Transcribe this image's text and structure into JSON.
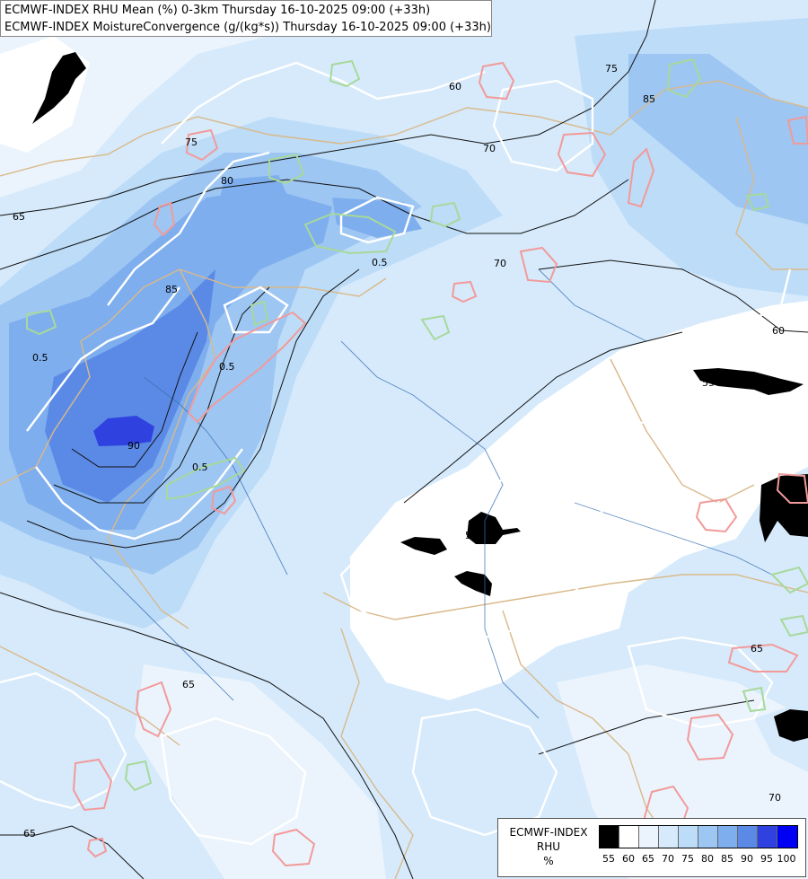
{
  "title": {
    "line1": "ECMWF-INDEX RHU Mean (%) 0-3km Thursday 16-10-2025 09:00 (+33h)",
    "line2": "ECMWF-INDEX MoistureConvergence (g/(kg*s)) Thursday 16-10-2025 09:00 (+33h)"
  },
  "legend": {
    "line1": "ECMWF-INDEX",
    "line2": "RHU",
    "unit": "%",
    "colors": [
      "#000000",
      "#ffffff",
      "#ebf4fd",
      "#d6eafb",
      "#bddcf8",
      "#9dc6f3",
      "#7eaeee",
      "#5b8ae6",
      "#2f42e0",
      "#0000f5"
    ],
    "ticks": [
      "55",
      "60",
      "65",
      "70",
      "75",
      "80",
      "85",
      "90",
      "95",
      "100"
    ]
  },
  "contour_labels": [
    {
      "id": "c65a",
      "text": "65"
    },
    {
      "id": "c80a",
      "text": "80"
    },
    {
      "id": "c85a",
      "text": "85"
    },
    {
      "id": "c90a",
      "text": "90"
    },
    {
      "id": "c75a",
      "text": "75"
    },
    {
      "id": "c65b",
      "text": "65"
    },
    {
      "id": "c65c",
      "text": "65"
    },
    {
      "id": "c60a",
      "text": "60"
    },
    {
      "id": "c70a",
      "text": "70"
    },
    {
      "id": "c70b",
      "text": "70"
    },
    {
      "id": "c70c",
      "text": "70"
    },
    {
      "id": "c75b",
      "text": "75"
    },
    {
      "id": "c85b",
      "text": "85"
    },
    {
      "id": "c60b",
      "text": "60"
    },
    {
      "id": "c55a",
      "text": "55"
    },
    {
      "id": "c50a",
      "text": "50"
    },
    {
      "id": "c65d",
      "text": "65"
    },
    {
      "id": "c05a",
      "text": "0.5"
    },
    {
      "id": "c05b",
      "text": "0.5"
    },
    {
      "id": "c05c",
      "text": "0.5"
    },
    {
      "id": "c05d",
      "text": "0.5"
    }
  ]
}
